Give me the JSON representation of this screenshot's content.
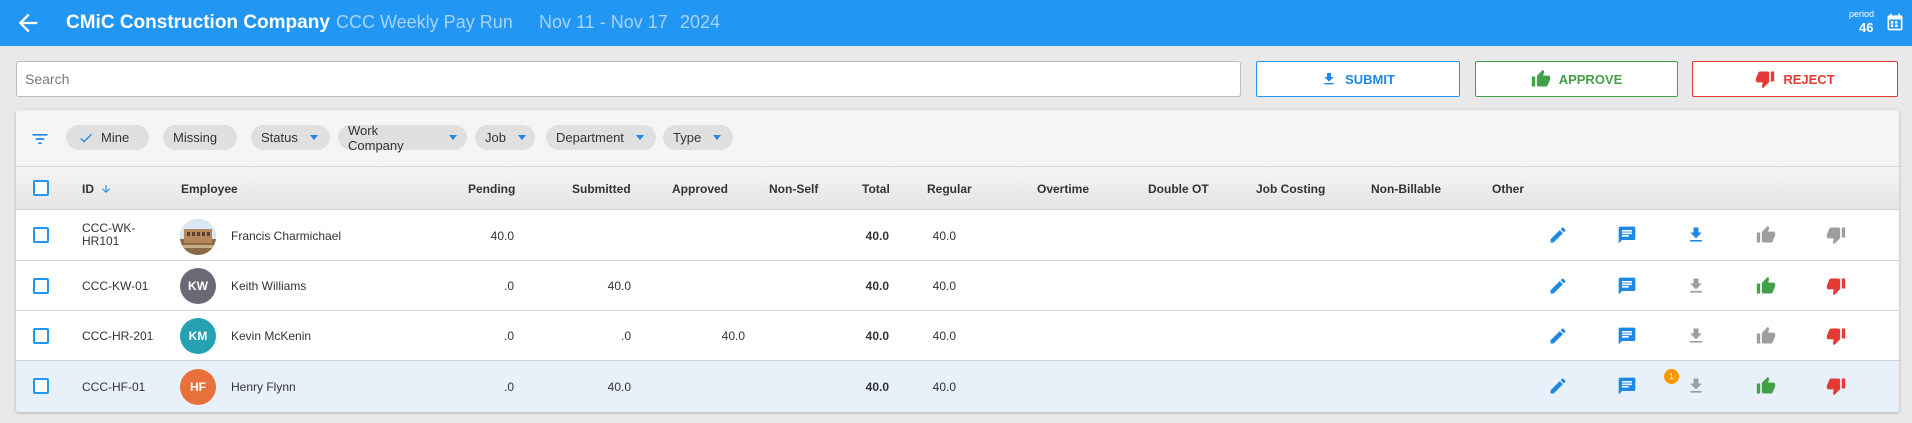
{
  "header": {
    "company": "CMiC Construction Company",
    "run_name": "CCC Weekly Pay Run",
    "dates": "Nov 11 - Nov 17",
    "year": "2024",
    "period_label": "period",
    "period_value": "46"
  },
  "search": {
    "placeholder": "Search",
    "value": ""
  },
  "actions": {
    "submit": "SUBMIT",
    "approve": "APPROVE",
    "reject": "REJECT"
  },
  "filters": {
    "chips": [
      {
        "label": "Mine",
        "checked": true,
        "dropdown": false
      },
      {
        "label": "Missing",
        "checked": false,
        "dropdown": false
      },
      {
        "label": "Status",
        "checked": false,
        "dropdown": true
      },
      {
        "label": "Work Company",
        "checked": false,
        "dropdown": true
      },
      {
        "label": "Job",
        "checked": false,
        "dropdown": true
      },
      {
        "label": "Department",
        "checked": false,
        "dropdown": true
      },
      {
        "label": "Type",
        "checked": false,
        "dropdown": true
      }
    ]
  },
  "table": {
    "columns": {
      "id": "ID",
      "employee": "Employee",
      "pending": "Pending",
      "submitted": "Submitted",
      "approved": "Approved",
      "nonself": "Non-Self",
      "total": "Total",
      "regular": "Regular",
      "overtime": "Overtime",
      "doubleot": "Double OT",
      "jobcosting": "Job Costing",
      "nonbillable": "Non-Billable",
      "other": "Other"
    },
    "rows": [
      {
        "id": "CCC-WK-HR101",
        "name": "Francis Charmichael",
        "initials": "",
        "avatar_color": "#b08d62",
        "pending": "40.0",
        "submitted": "",
        "approved": "",
        "total": "40.0",
        "regular": "40.0",
        "download_active": true,
        "approve_active": false,
        "reject_active": false,
        "badge": ""
      },
      {
        "id": "CCC-KW-01",
        "name": "Keith Williams",
        "initials": "KW",
        "avatar_color": "#6d6875",
        "pending": ".0",
        "submitted": "40.0",
        "approved": "",
        "total": "40.0",
        "regular": "40.0",
        "download_active": false,
        "approve_active": true,
        "reject_active": true,
        "badge": ""
      },
      {
        "id": "CCC-HR-201",
        "name": "Kevin McKenin",
        "initials": "KM",
        "avatar_color": "#26a0b3",
        "pending": ".0",
        "submitted": ".0",
        "approved": "40.0",
        "total": "40.0",
        "regular": "40.0",
        "download_active": false,
        "approve_active": false,
        "reject_active": true,
        "badge": ""
      },
      {
        "id": "CCC-HF-01",
        "name": "Henry Flynn",
        "initials": "HF",
        "avatar_color": "#e8703a",
        "pending": ".0",
        "submitted": "40.0",
        "approved": "",
        "total": "40.0",
        "regular": "40.0",
        "download_active": false,
        "approve_active": true,
        "reject_active": true,
        "badge": "1"
      }
    ]
  },
  "colors": {
    "primary": "#2196f3",
    "approve": "#43a047",
    "reject": "#e53935",
    "inactive": "#9e9e9e",
    "badge": "#ff9800"
  }
}
